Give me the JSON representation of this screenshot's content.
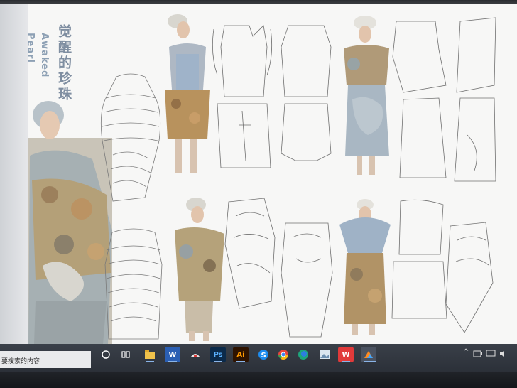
{
  "artwork": {
    "title_cn": "觉醒的珍珠",
    "title_en_line1": "Awaked",
    "title_en_line2": "Pearl"
  },
  "taskbar": {
    "search_placeholder": "要搜索的内容",
    "apps": [
      {
        "name": "start",
        "label": ""
      },
      {
        "name": "search",
        "label": ""
      },
      {
        "name": "task-view",
        "label": ""
      },
      {
        "name": "file-explorer",
        "label": ""
      },
      {
        "name": "word",
        "label": "W"
      },
      {
        "name": "baidu-netdisk",
        "label": ""
      },
      {
        "name": "photoshop",
        "label": "Ps"
      },
      {
        "name": "illustrator",
        "label": "Ai"
      },
      {
        "name": "sogou",
        "label": "S"
      },
      {
        "name": "chrome",
        "label": ""
      },
      {
        "name": "edge",
        "label": ""
      },
      {
        "name": "image-viewer",
        "label": ""
      },
      {
        "name": "wps",
        "label": "W"
      },
      {
        "name": "app-blue",
        "label": ""
      }
    ],
    "tray_chevron": "^"
  },
  "colors": {
    "title_blue": "#7f8ea1",
    "ps_blue": "#0b2a4a",
    "ai_orange": "#2e1300",
    "wps_red": "#e13a3a"
  }
}
